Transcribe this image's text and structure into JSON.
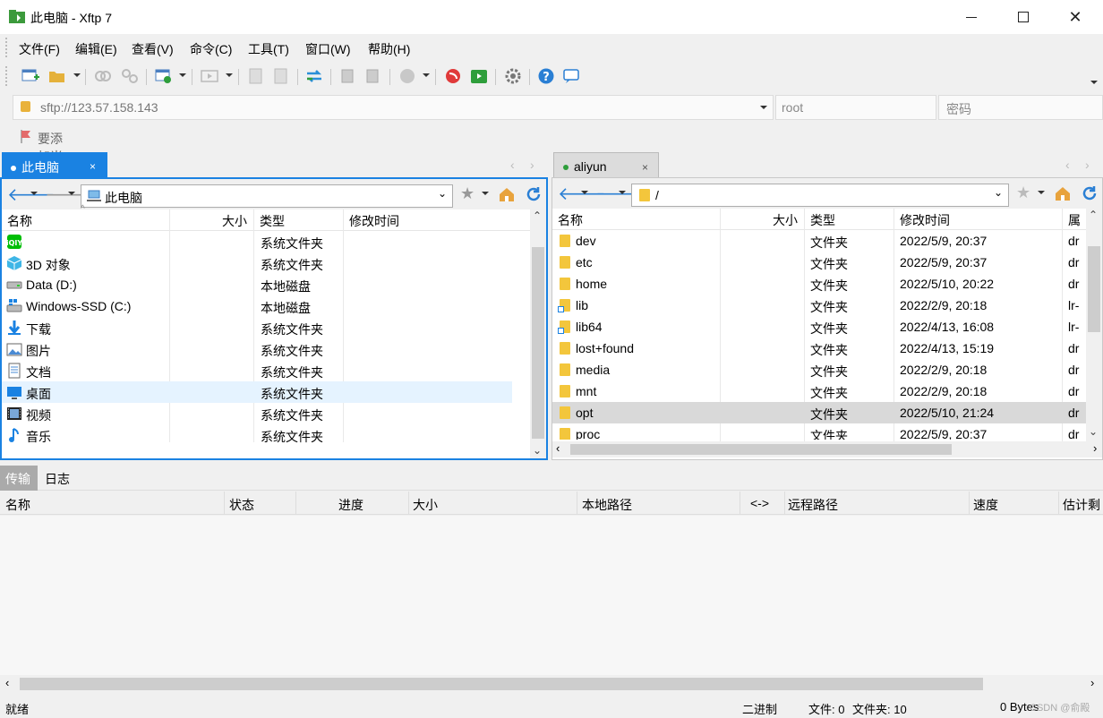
{
  "window": {
    "title": "此电脑 - Xftp 7",
    "min_icon": "minimize-icon",
    "max_icon": "maximize-icon",
    "close_icon": "close-icon"
  },
  "menu": [
    "文件(F)",
    "编辑(E)",
    "查看(V)",
    "命令(C)",
    "工具(T)",
    "窗口(W)",
    "帮助(H)"
  ],
  "address": {
    "host": "sftp://123.57.158.143",
    "user_placeholder": "root",
    "password_placeholder": "密码"
  },
  "hint": "要添加当前会话，点击左侧的箭头按钮。",
  "left": {
    "tab": "此电脑",
    "tab_close": "×",
    "path": "此电脑",
    "columns": [
      "名称",
      "大小",
      "类型",
      "修改时间"
    ],
    "rows": [
      {
        "name": "",
        "type": "系统文件夹",
        "icon": "iqiyi-icon"
      },
      {
        "name": "3D 对象",
        "type": "系统文件夹",
        "icon": "cube-icon"
      },
      {
        "name": "Data (D:)",
        "type": "本地磁盘",
        "icon": "drive-icon"
      },
      {
        "name": "Windows-SSD (C:)",
        "type": "本地磁盘",
        "icon": "windows-drive-icon"
      },
      {
        "name": "下载",
        "type": "系统文件夹",
        "icon": "download-icon"
      },
      {
        "name": "图片",
        "type": "系统文件夹",
        "icon": "pictures-icon"
      },
      {
        "name": "文档",
        "type": "系统文件夹",
        "icon": "documents-icon"
      },
      {
        "name": "桌面",
        "type": "系统文件夹",
        "icon": "desktop-icon"
      },
      {
        "name": "视频",
        "type": "系统文件夹",
        "icon": "video-icon"
      },
      {
        "name": "音乐",
        "type": "系统文件夹",
        "icon": "music-icon"
      }
    ]
  },
  "right": {
    "tab": "aliyun",
    "tab_close": "×",
    "path": "/",
    "columns": [
      "名称",
      "大小",
      "类型",
      "修改时间",
      "属性"
    ],
    "rows": [
      {
        "name": "dev",
        "type": "文件夹",
        "modified": "2022/5/9, 20:37",
        "attr": "dr"
      },
      {
        "name": "etc",
        "type": "文件夹",
        "modified": "2022/5/9, 20:37",
        "attr": "dr"
      },
      {
        "name": "home",
        "type": "文件夹",
        "modified": "2022/5/10, 20:22",
        "attr": "dr"
      },
      {
        "name": "lib",
        "type": "文件夹",
        "modified": "2022/2/9, 20:18",
        "attr": "lr-"
      },
      {
        "name": "lib64",
        "type": "文件夹",
        "modified": "2022/4/13, 16:08",
        "attr": "lr-"
      },
      {
        "name": "lost+found",
        "type": "文件夹",
        "modified": "2022/4/13, 15:19",
        "attr": "dr"
      },
      {
        "name": "media",
        "type": "文件夹",
        "modified": "2022/2/9, 20:18",
        "attr": "dr"
      },
      {
        "name": "mnt",
        "type": "文件夹",
        "modified": "2022/2/9, 20:18",
        "attr": "dr"
      },
      {
        "name": "opt",
        "type": "文件夹",
        "modified": "2022/5/10, 21:24",
        "attr": "dr"
      },
      {
        "name": "proc",
        "type": "文件夹",
        "modified": "2022/5/9, 20:37",
        "attr": "dr"
      }
    ]
  },
  "transfer": {
    "tabs": [
      "传输",
      "日志"
    ],
    "columns": [
      "名称",
      "状态",
      "进度",
      "大小",
      "本地路径",
      "<->",
      "远程路径",
      "速度",
      "估计剩"
    ]
  },
  "status": {
    "left": "就绪",
    "mode": "二进制",
    "files": "文件: 0",
    "folders": "文件夹: 10",
    "bytes": "0 Bytes",
    "watermark": "CSDN @俞殿"
  },
  "colors": {
    "accent": "#1a82e2",
    "selected_row": "#e5f3ff",
    "remote_selected_row": "#d9d9d9"
  }
}
